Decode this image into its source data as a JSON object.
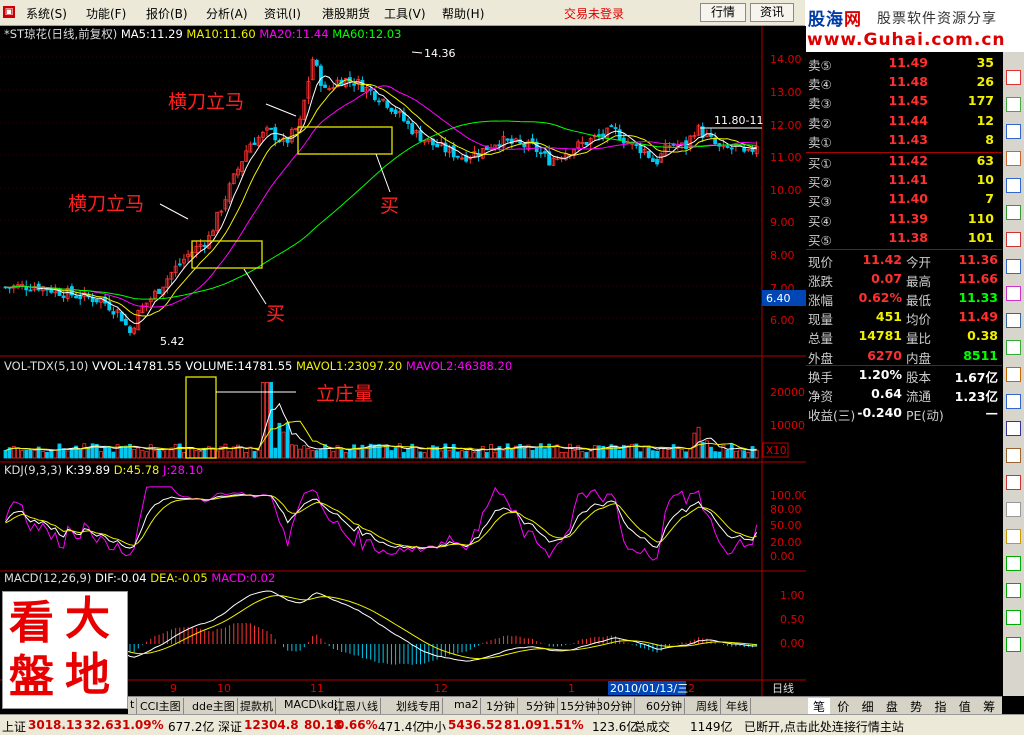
{
  "menu": {
    "items": [
      "系统(S)",
      "功能(F)",
      "报价(B)",
      "分析(A)",
      "资讯(I)",
      "港股期货",
      "工具(V)",
      "帮助(H)"
    ],
    "login_status": "交易未登录",
    "btn_quote": "行情",
    "btn_news": "资讯"
  },
  "watermark": {
    "brand_a": "股海",
    "brand_b": "网",
    "slogan": "股票软件资源分享",
    "url": "www.Guhai.com.cn"
  },
  "main_chart": {
    "title": "*ST琼花(日线,前复权)",
    "ma5": "MA5:11.29",
    "ma10": "MA10:11.60",
    "ma20": "MA20:11.44",
    "ma60": "MA60:12.03",
    "yticks": [
      "14.00",
      "13.00",
      "12.00",
      "11.00",
      "10.00",
      "9.00",
      "8.00",
      "7.00",
      "6.00"
    ],
    "high_label": "14.36",
    "low_label": "5.42",
    "last_label": "11.80-11",
    "price_tag": "6.40",
    "annotations": [
      {
        "text": "横刀立马"
      },
      {
        "text": "横刀立马"
      },
      {
        "text": "买"
      },
      {
        "text": "买"
      }
    ],
    "colors": {
      "up": "#ff3333",
      "down": "#00c8f0",
      "ma5": "#ffffff",
      "ma10": "#f0f000",
      "ma20": "#ff00ff",
      "ma60": "#00ff00",
      "axis": "#b00000"
    }
  },
  "vol_chart": {
    "title": "VOL-TDX(5,10)",
    "vvol": "VVOL:14781.55",
    "volume": "VOLUME:14781.55",
    "mavol1": "MAVOL1:23097.20",
    "mavol2": "MAVOL2:46388.20",
    "yticks": [
      "20000",
      "10000"
    ],
    "unit": "X10",
    "annotation": "立庄量"
  },
  "kdj_chart": {
    "title": "KDJ(9,3,3)",
    "k": "K:39.89",
    "d": "D:45.78",
    "j": "J:28.10",
    "yticks": [
      "100.00",
      "80.00",
      "50.00",
      "20.00",
      "0.00"
    ]
  },
  "macd_chart": {
    "title": "MACD(12,26,9)",
    "dif": "DIF:-0.04",
    "dea": "DEA:-0.05",
    "macd": "MACD:0.02",
    "yticks": [
      "1.00",
      "0.50",
      "0.00"
    ]
  },
  "date_axis": {
    "labels": [
      "9",
      "10",
      "11",
      "12",
      "1",
      "2"
    ],
    "cursor": "2010/01/13/三",
    "period": "日线"
  },
  "quote": {
    "sell": [
      {
        "label": "卖⑤",
        "price": "11.49",
        "vol": "35"
      },
      {
        "label": "卖④",
        "price": "11.48",
        "vol": "26"
      },
      {
        "label": "卖③",
        "price": "11.45",
        "vol": "177"
      },
      {
        "label": "卖②",
        "price": "11.44",
        "vol": "12"
      },
      {
        "label": "卖①",
        "price": "11.43",
        "vol": "8"
      }
    ],
    "buy": [
      {
        "label": "买①",
        "price": "11.42",
        "vol": "63"
      },
      {
        "label": "买②",
        "price": "11.41",
        "vol": "10"
      },
      {
        "label": "买③",
        "price": "11.40",
        "vol": "7"
      },
      {
        "label": "买④",
        "price": "11.39",
        "vol": "110"
      },
      {
        "label": "买⑤",
        "price": "11.38",
        "vol": "101"
      }
    ],
    "stats": [
      {
        "l1": "现价",
        "v1": "11.42",
        "l2": "今开",
        "v2": "11.36"
      },
      {
        "l1": "涨跌",
        "v1": "0.07",
        "l2": "最高",
        "v2": "11.66"
      },
      {
        "l1": "涨幅",
        "v1": "0.62%",
        "l2": "最低",
        "v2": "11.33"
      },
      {
        "l1": "现量",
        "v1": "451",
        "l2": "均价",
        "v2": "11.49"
      },
      {
        "l1": "总量",
        "v1": "14781",
        "l2": "量比",
        "v2": "0.38"
      },
      {
        "l1": "外盘",
        "v1": "6270",
        "l2": "内盘",
        "v2": "8511"
      }
    ],
    "extra": [
      {
        "l1": "换手",
        "v1": "1.20%",
        "l2": "股本",
        "v2": "1.67亿"
      },
      {
        "l1": "净资",
        "v1": "0.64",
        "l2": "流通",
        "v2": "1.23亿"
      },
      {
        "l1": "收益(三)",
        "v1": "-0.240",
        "l2": "PE(动)",
        "v2": "—"
      }
    ]
  },
  "right_tabs": [
    "笔",
    "价",
    "细",
    "盘",
    "势",
    "指",
    "值",
    "筹"
  ],
  "bottom_tabs": [
    "t",
    "CCI主图",
    "dde主图",
    "提款机",
    "MACD\\kdj",
    "江恩八线",
    "划线专用",
    "ma2",
    "1分钟",
    "5分钟",
    "15分钟",
    "30分钟",
    "60分钟",
    "周线",
    "年线"
  ],
  "status": {
    "sh_label": "上证",
    "sh_idx": "3018.13",
    "sh_chg": "32.63",
    "sh_pct": "1.09%",
    "sh_amt": "677.2亿",
    "sz_label": "深证",
    "sz_idx": "12304.8",
    "sz_chg": "80.18",
    "sz_pct": "0.66%",
    "sz_amt": "471.4亿",
    "zx_label": "中小",
    "zx_idx": "5436.52",
    "zx_chg": "81.09",
    "zx_pct": "1.51%",
    "zx_amt": "123.6亿",
    "total_label": "总成交",
    "total": "1149亿",
    "conn": "已断开,点击此处连接行情主站"
  },
  "logo": {
    "c1": "看",
    "c2": "大",
    "c3": "盤",
    "c4": "地"
  }
}
